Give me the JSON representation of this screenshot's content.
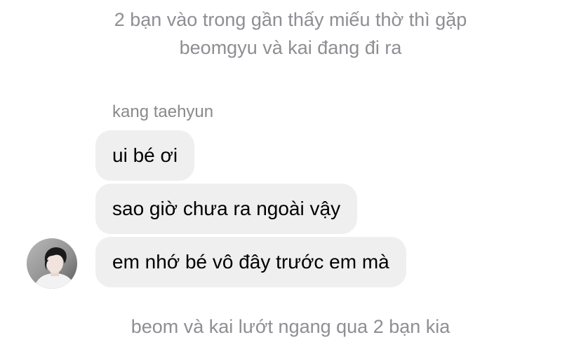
{
  "narration_top": "2 bạn vào trong gần thấy miếu thờ thì gặp beomgyu và kai đang đi ra",
  "sender": {
    "name": "kang taehyun",
    "avatar_icon": "person-avatar"
  },
  "messages": [
    {
      "text": "ui bé ơi"
    },
    {
      "text": "sao giờ chưa ra ngoài vậy"
    },
    {
      "text": "em nhớ bé vô đây trước em mà"
    }
  ],
  "narration_bottom": "beom và kai lướt ngang qua 2 bạn kia",
  "colors": {
    "bubble_bg": "#efefef",
    "narration_text": "#8e8e93",
    "message_text": "#000000"
  }
}
